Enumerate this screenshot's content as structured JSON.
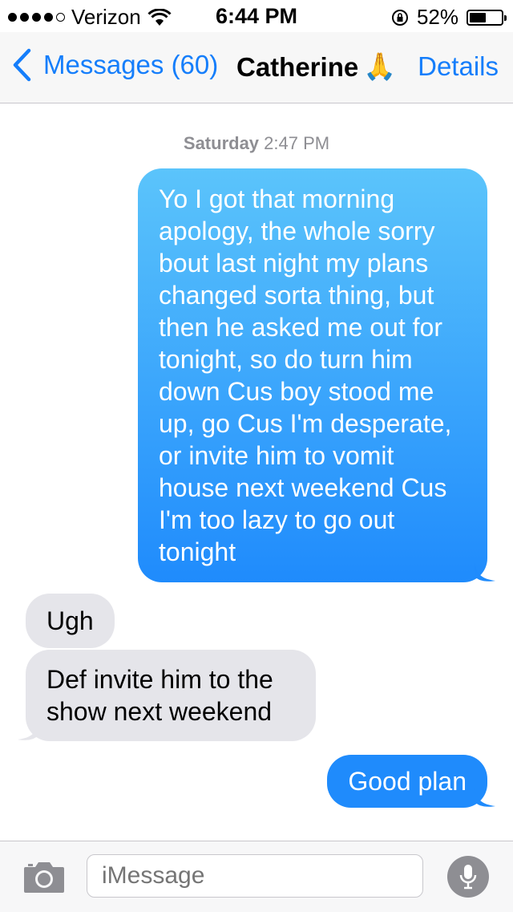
{
  "status": {
    "carrier": "Verizon",
    "time": "6:44 PM",
    "battery_label": "52%",
    "battery_level": 0.52
  },
  "nav": {
    "back_label": "Messages (60)",
    "contact_name": "Catherine",
    "contact_emoji": "🙏",
    "details_label": "Details"
  },
  "thread": {
    "day": "Saturday",
    "time": "2:47 PM",
    "messages": [
      {
        "from": "me",
        "text": "Yo I got that morning apology, the whole sorry bout last night my plans changed sorta thing, but then he asked me out for tonight, so do turn him down Cus boy stood me up, go Cus I'm desperate, or invite him to vomit house next weekend Cus I'm too lazy to go out tonight"
      },
      {
        "from": "them",
        "text": "Ugh"
      },
      {
        "from": "them",
        "text": "Def invite him to the show next weekend"
      },
      {
        "from": "me",
        "text": "Good plan"
      }
    ]
  },
  "composer": {
    "placeholder": "iMessage"
  },
  "colors": {
    "accent": "#157efb",
    "outgoing_top": "#5bc4fb",
    "outgoing_bottom": "#1f8bfc",
    "incoming": "#e5e5ea"
  }
}
